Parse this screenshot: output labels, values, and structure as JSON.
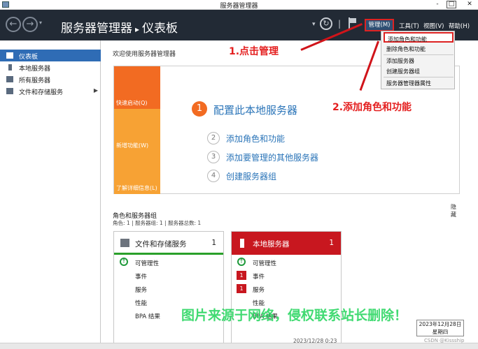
{
  "window": {
    "title": "服务器管理器",
    "min": "-",
    "max": "□",
    "close": "✕"
  },
  "header": {
    "breadcrumb_root": "服务器管理器",
    "breadcrumb_sep": "▸",
    "breadcrumb_current": "仪表板",
    "back": "←",
    "forward": "→",
    "dropdown_chev": "▾",
    "refresh": "↻",
    "separator": "|",
    "menus": {
      "manage": "管理(M)",
      "tools": "工具(T)",
      "view": "视图(V)",
      "help": "帮助(H)"
    }
  },
  "sidebar": {
    "items": [
      {
        "label": "仪表板",
        "icon": "dashboard-icon",
        "active": true
      },
      {
        "label": "本地服务器",
        "icon": "server-icon"
      },
      {
        "label": "所有服务器",
        "icon": "servers-icon"
      },
      {
        "label": "文件和存储服务",
        "icon": "file-storage-icon",
        "chev": "▶"
      }
    ]
  },
  "main": {
    "welcome": "欢迎使用服务器管理器",
    "quickstart": {
      "tiles": [
        "快速启动(Q)",
        "新增功能(W)",
        "了解详细信息(L)"
      ],
      "steps": [
        {
          "num": "1",
          "text": "配置此本地服务器"
        },
        {
          "num": "2",
          "text": "添加角色和功能"
        },
        {
          "num": "3",
          "text": "添加要管理的其他服务器"
        },
        {
          "num": "4",
          "text": "创建服务器组"
        }
      ],
      "hide": "隐藏"
    },
    "roles": {
      "title": "角色和服务器组",
      "subtitle": "角色: 1 | 服务器组: 1 | 服务器总数: 1",
      "cards": [
        {
          "name": "文件和存储服务",
          "count": "1",
          "rows": [
            "可管理性",
            "事件",
            "服务",
            "性能",
            "BPA 结果"
          ],
          "ok": "↑"
        },
        {
          "name": "本地服务器",
          "count": "1",
          "rows": [
            "可管理性",
            "事件",
            "服务",
            "性能",
            "BPA 结果"
          ],
          "badges": [
            "1",
            "1"
          ],
          "ok": "↑",
          "timestamp": "2023/12/28 0:23"
        }
      ]
    }
  },
  "manage_menu": {
    "items": [
      "添加角色和功能",
      "删除角色和功能",
      "添加服务器",
      "创建服务器组",
      "服务器管理器属性"
    ]
  },
  "annotations": {
    "step1": "1.点击管理",
    "step2": "2.添加角色和功能"
  },
  "watermark": "图片来源于网络，侵权联系站长删除！",
  "taskbar": {
    "date": "2023年12月28日",
    "weekday": "星期四"
  },
  "credit": "CSDN @Kissship",
  "colors": {
    "header_bg": "#222a35",
    "accent": "#2f6cb5",
    "orange": "#f26b22",
    "red": "#c8171f",
    "annotation": "#e41e1e"
  }
}
